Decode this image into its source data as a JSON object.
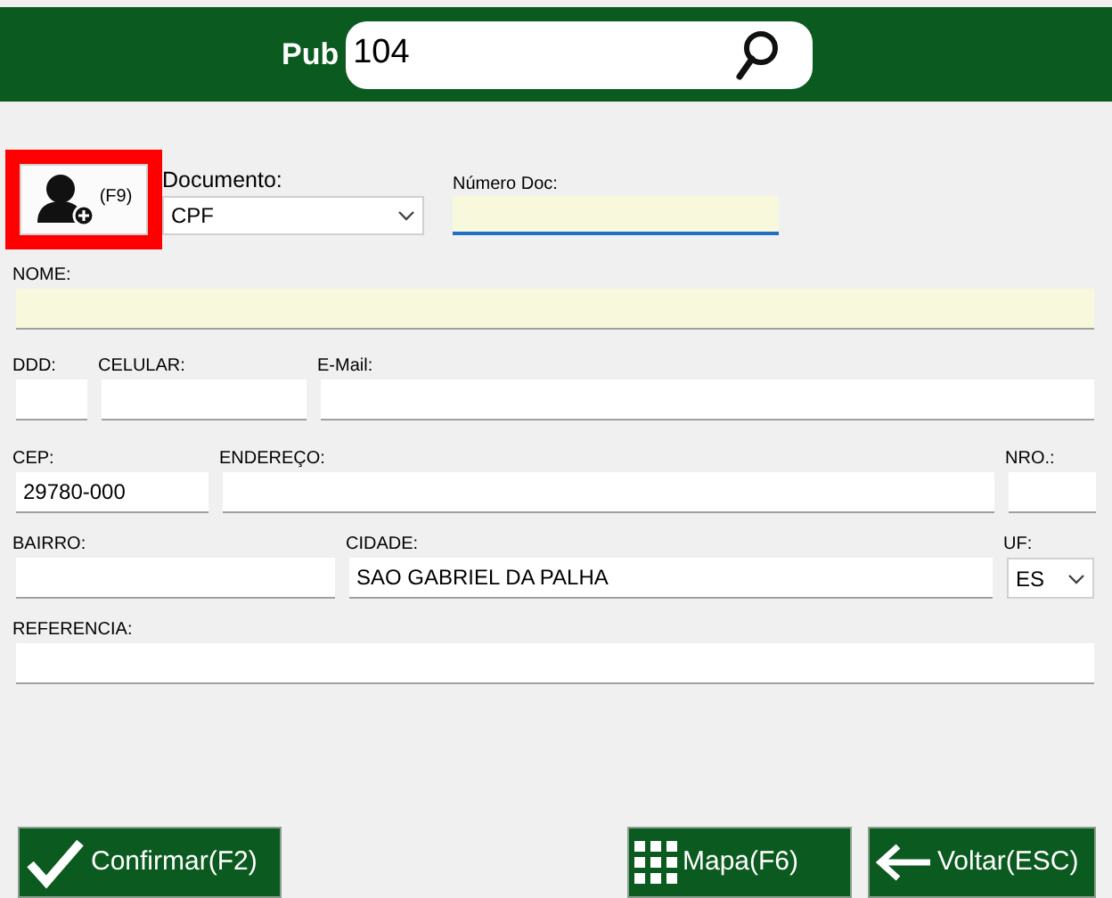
{
  "header": {
    "label": "Pub",
    "search_value": "104"
  },
  "add_client_button": {
    "shortcut": "(F9)",
    "highlighted": true
  },
  "document": {
    "label": "Documento:",
    "value": "CPF"
  },
  "document_number": {
    "label": "Número Doc:",
    "required": true,
    "focused": true
  },
  "rows": [
    [
      {
        "kind": "text",
        "label": "NOME:",
        "required": true
      }
    ],
    [
      {
        "kind": "text",
        "label": "DDD:",
        "required": false
      },
      {
        "kind": "text",
        "label": "CELULAR:",
        "required": false
      },
      {
        "kind": "text",
        "label": "E-Mail:",
        "required": false
      }
    ],
    [
      {
        "kind": "text",
        "label": "CEP:",
        "value": "29780-000",
        "required": false
      },
      {
        "kind": "text",
        "label": "ENDEREÇO:",
        "required": false
      },
      {
        "kind": "text",
        "label": "NRO.:",
        "required": false
      }
    ],
    [
      {
        "kind": "text",
        "label": "BAIRRO:",
        "required": false
      },
      {
        "kind": "text",
        "label": "CIDADE:",
        "value": "SAO GABRIEL DA PALHA",
        "required": false
      },
      {
        "kind": "select",
        "label": "UF:",
        "value": "ES"
      }
    ],
    [
      {
        "kind": "text",
        "label": "REFERENCIA:",
        "required": false
      }
    ]
  ],
  "buttons": [
    {
      "kind": "confirm",
      "label": "Confirmar(F2)"
    },
    {
      "kind": "map",
      "label": "Mapa(F6)"
    },
    {
      "kind": "back",
      "label": "Voltar(ESC)"
    }
  ]
}
